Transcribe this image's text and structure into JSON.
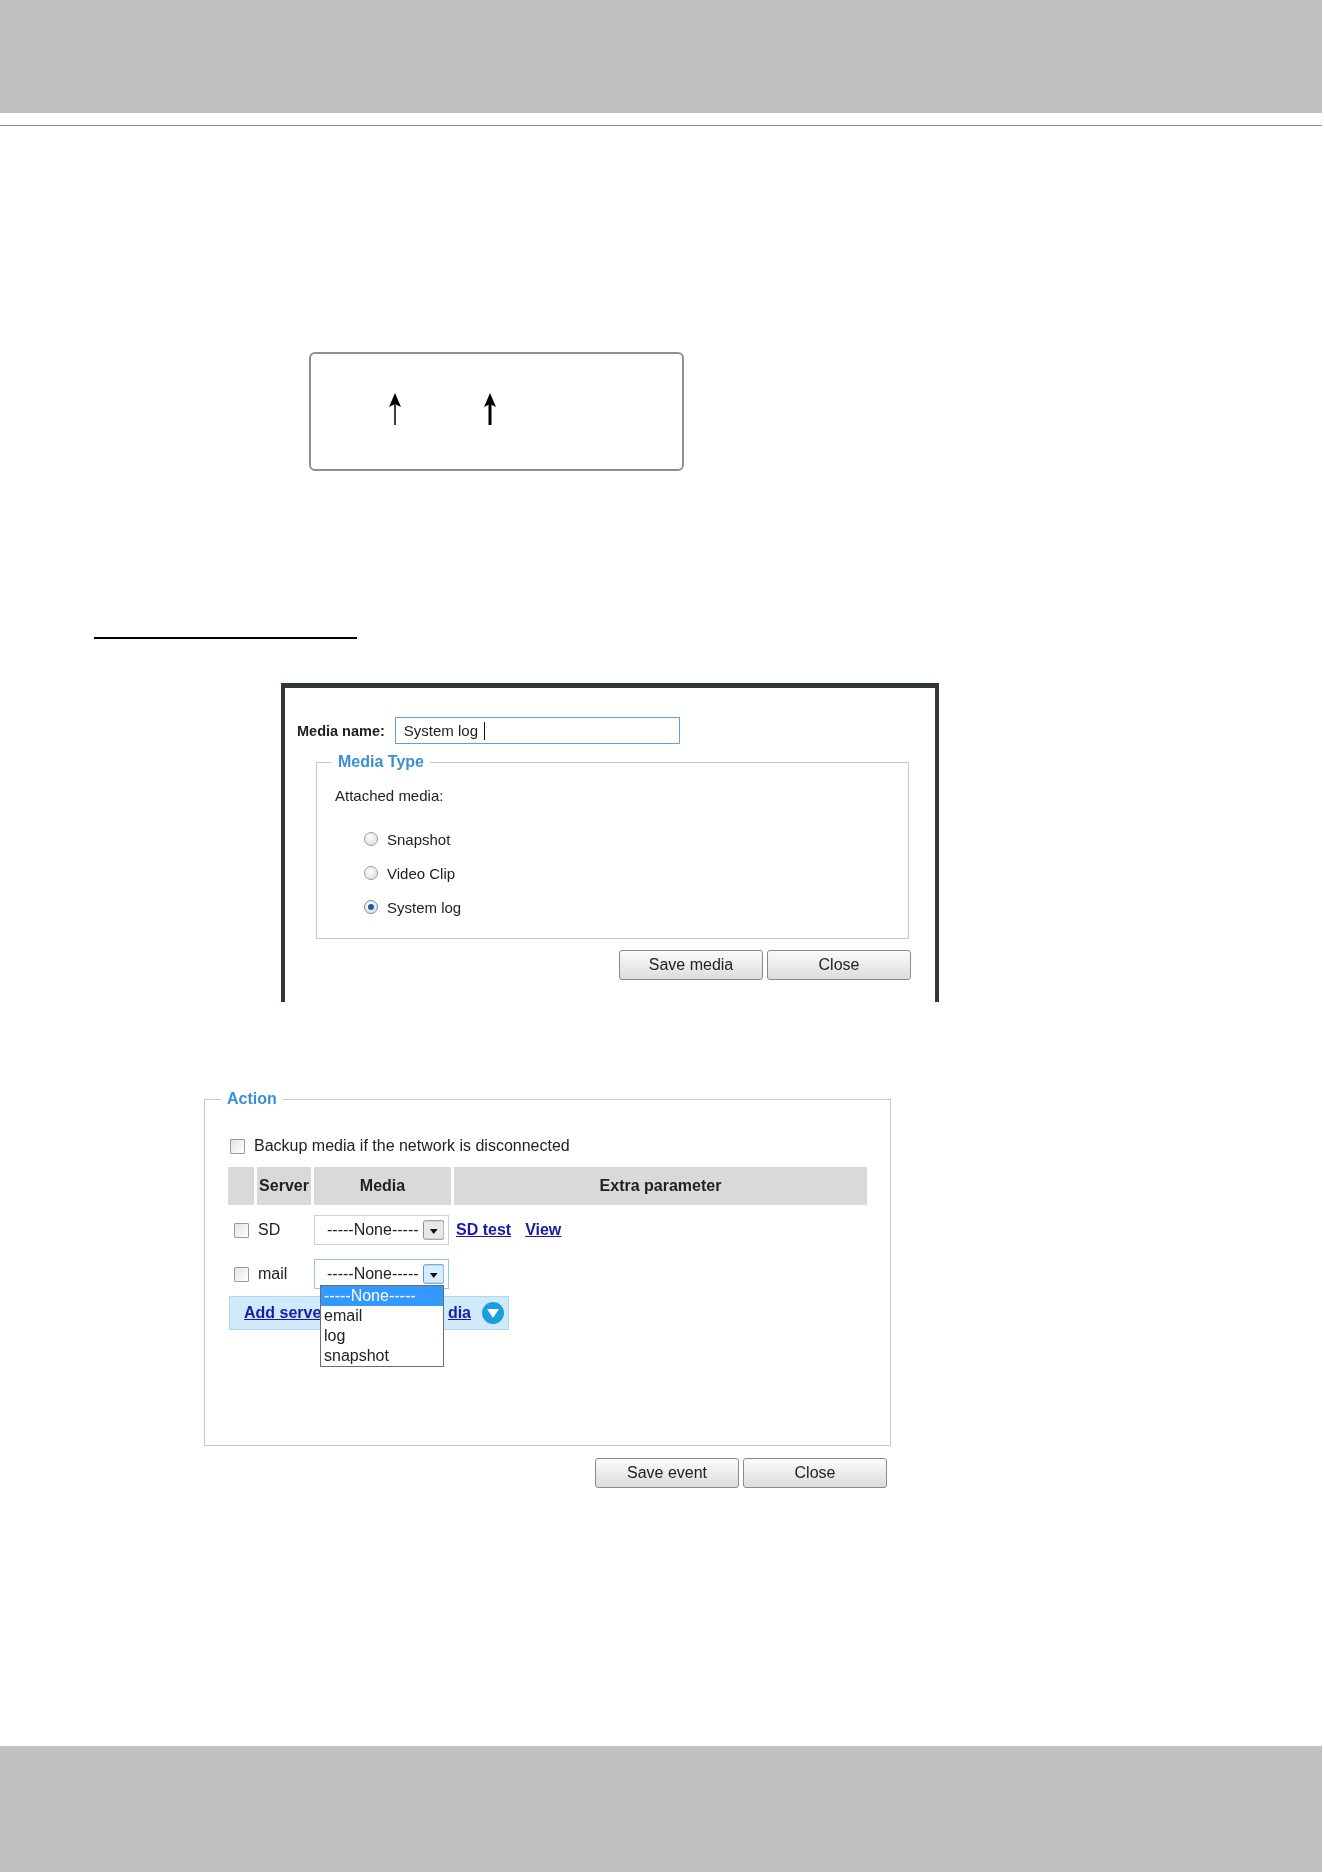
{
  "media_dialog": {
    "name_label": "Media name:",
    "name_field": {
      "value": "System log",
      "focused": true
    },
    "legend": "Media Type",
    "attached_label": "Attached media:",
    "options": [
      {
        "label": "Snapshot",
        "selected": false
      },
      {
        "label": "Video Clip",
        "selected": false
      },
      {
        "label": "System log",
        "selected": true
      }
    ],
    "buttons": [
      "Save media",
      "Close"
    ]
  },
  "action_dialog": {
    "legend": "Action",
    "backup": {
      "label": "Backup media if the network is disconnected",
      "checked": false
    },
    "table": {
      "columns": [
        "Server",
        "Media",
        "Extra parameter"
      ],
      "rows": [
        {
          "checked": false,
          "server": "SD",
          "media": "-----None-----",
          "open": false,
          "links": [
            "SD test",
            "View"
          ]
        },
        {
          "checked": false,
          "server": "mail",
          "media": "-----None-----",
          "open": true,
          "options": [
            {
              "label": "-----None-----",
              "selected": true
            },
            {
              "label": "email",
              "selected": false
            },
            {
              "label": "log",
              "selected": false
            },
            {
              "label": "snapshot",
              "selected": false
            }
          ]
        }
      ]
    },
    "add_links": [
      "Add serve",
      "dia"
    ],
    "buttons": [
      "Save event",
      "Close"
    ]
  }
}
